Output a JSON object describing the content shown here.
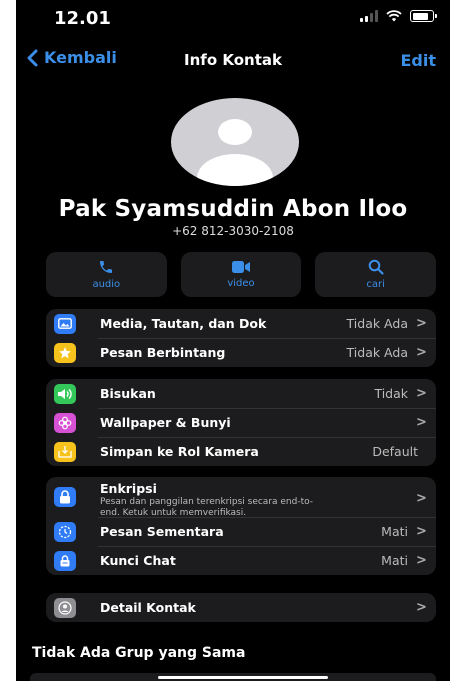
{
  "status": {
    "time": "12.01"
  },
  "nav": {
    "back_label": "Kembali",
    "title": "Info Kontak",
    "edit_label": "Edit"
  },
  "contact": {
    "name": "Pak Syamsuddin Abon Iloo",
    "phone": "+62 812-3030-2108"
  },
  "actions": [
    {
      "label": "audio",
      "icon": "phone-icon"
    },
    {
      "label": "video",
      "icon": "video-icon"
    },
    {
      "label": "cari",
      "icon": "search-icon"
    }
  ],
  "group1": [
    {
      "label": "Media, Tautan, dan Dok",
      "value": "Tidak Ada",
      "icon": "photo-icon",
      "color": "#2f7cf6"
    },
    {
      "label": "Pesan Berbintang",
      "value": "Tidak Ada",
      "icon": "star-icon",
      "color": "#f7c21c"
    }
  ],
  "group2": [
    {
      "label": "Bisukan",
      "value": "Tidak",
      "icon": "speaker-icon",
      "color": "#34c759"
    },
    {
      "label": "Wallpaper & Bunyi",
      "value": "",
      "icon": "flower-icon",
      "color": "#d651d4"
    },
    {
      "label": "Simpan ke Rol Kamera",
      "value": "Default",
      "icon": "save-icon",
      "color": "#f7c21c"
    }
  ],
  "group3": [
    {
      "label": "Enkripsi",
      "sub1": "Pesan dan panggilan terenkripsi secara end-to-",
      "sub2": "end. Ketuk untuk memverifikasi.",
      "icon": "lock-icon",
      "color": "#2f7cf6"
    },
    {
      "label": "Pesan Sementara",
      "value": "Mati",
      "icon": "timer-icon",
      "color": "#2f7cf6"
    },
    {
      "label": "Kunci Chat",
      "value": "Mati",
      "icon": "chat-lock-icon",
      "color": "#2f7cf6"
    }
  ],
  "group4": [
    {
      "label": "Detail Kontak",
      "icon": "contact-card-icon",
      "color": "#8e8e93"
    }
  ],
  "section": {
    "title": "Tidak Ada Grup yang Sama"
  },
  "chev": ">"
}
